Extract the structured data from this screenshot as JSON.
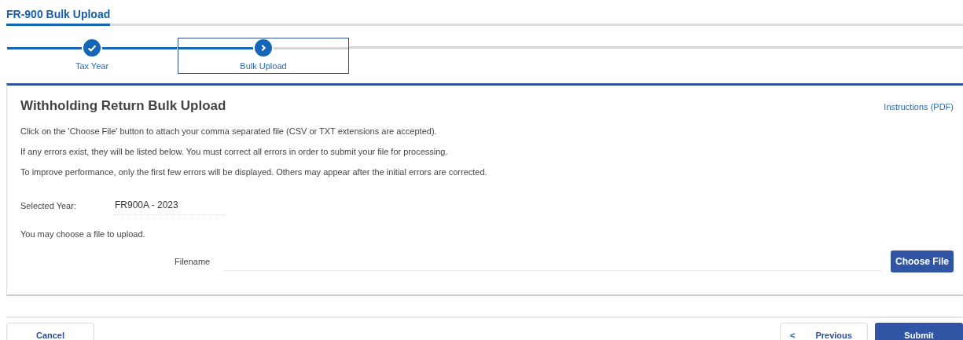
{
  "page_title": "FR-900 Bulk Upload",
  "steps": [
    {
      "label": "Tax Year",
      "completed": true,
      "selected": false
    },
    {
      "label": "Bulk Upload",
      "completed": false,
      "selected": true
    }
  ],
  "card": {
    "title": "Withholding Return Bulk Upload",
    "instructions_link": "Instructions (PDF)",
    "paragraphs": [
      "Click on the 'Choose File' button to attach your comma separated file (CSV or TXT extensions are accepted).",
      "If any errors exist, they will be listed below. You must correct all errors in order to submit your file for processing.",
      "To improve performance, only the first few errors will be displayed. Others may appear after the initial errors are corrected."
    ],
    "selected_year_label": "Selected Year:",
    "selected_year_value": "FR900A - 2023",
    "choose_prompt": "You may choose a file to upload.",
    "filename_label": "Filename",
    "choose_button": "Choose File"
  },
  "footer": {
    "cancel": "Cancel",
    "previous_icon": "<",
    "previous": "Previous",
    "submit": "Submit"
  }
}
